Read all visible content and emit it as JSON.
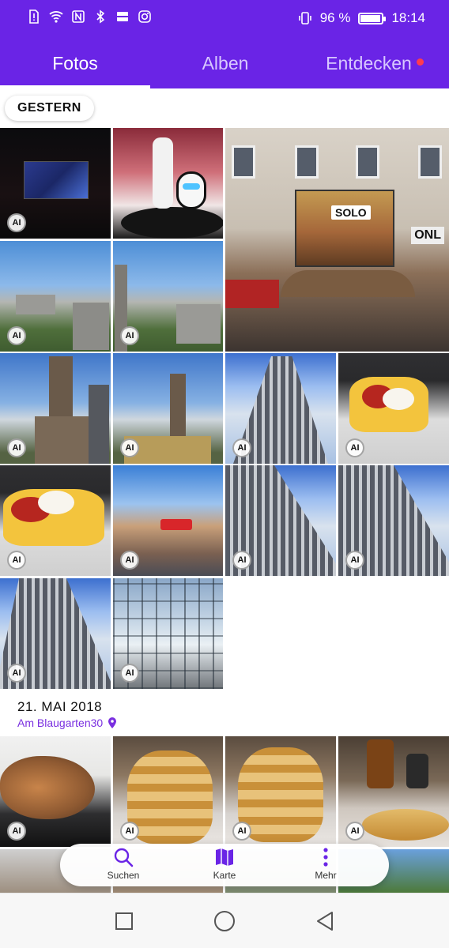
{
  "status_bar": {
    "battery_text": "96 %",
    "battery_level": 0.96,
    "time": "18:14"
  },
  "tabs": [
    {
      "label": "Fotos",
      "active": true
    },
    {
      "label": "Alben",
      "active": false
    },
    {
      "label": "Entdecken",
      "active": false,
      "notification_dot": true
    }
  ],
  "sections": [
    {
      "heading": "GESTERN",
      "photos": [
        {
          "subject": "cinema",
          "ai_badge": "AI"
        },
        {
          "subject": "robot",
          "ai_badge": ""
        },
        {
          "subject": "solo-cinema-building",
          "ai_badge": ""
        },
        {
          "subject": "city-view-1",
          "ai_badge": "AI"
        },
        {
          "subject": "city-view-2",
          "ai_badge": "AI"
        },
        {
          "subject": "church-1",
          "ai_badge": "AI"
        },
        {
          "subject": "church-2",
          "ai_badge": "AI"
        },
        {
          "subject": "tower-1",
          "ai_badge": "AI"
        },
        {
          "subject": "fries-1",
          "ai_badge": "AI"
        },
        {
          "subject": "fries-2",
          "ai_badge": "AI"
        },
        {
          "subject": "street",
          "ai_badge": "AI"
        },
        {
          "subject": "tower-2",
          "ai_badge": "AI"
        },
        {
          "subject": "tower-3",
          "ai_badge": "AI"
        },
        {
          "subject": "tower-4",
          "ai_badge": "AI"
        },
        {
          "subject": "glass-roof",
          "ai_badge": "AI"
        }
      ]
    },
    {
      "heading": "21. MAI 2018",
      "location": "Am Blaugarten30",
      "photos": [
        {
          "subject": "cat",
          "ai_badge": "AI"
        },
        {
          "subject": "pancakes-1",
          "ai_badge": "AI"
        },
        {
          "subject": "pancakes-2",
          "ai_badge": "AI"
        },
        {
          "subject": "kitchen",
          "ai_badge": "AI"
        }
      ]
    }
  ],
  "floating_menu": [
    {
      "label": "Suchen",
      "icon": "search-icon"
    },
    {
      "label": "Karte",
      "icon": "map-icon"
    },
    {
      "label": "Mehr",
      "icon": "more-vertical-icon"
    }
  ],
  "nav_bar": [
    {
      "icon": "recents-square-icon"
    },
    {
      "icon": "home-circle-icon"
    },
    {
      "icon": "back-triangle-icon"
    }
  ],
  "colors": {
    "accent": "#6a24e6",
    "notification_dot": "#ff3b4e",
    "location_text": "#7a2fe0"
  }
}
